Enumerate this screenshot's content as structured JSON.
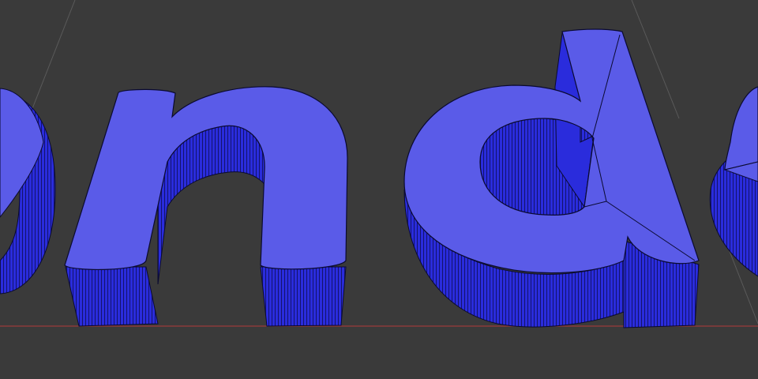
{
  "viewport": {
    "background_color": "#3a3a3a",
    "grid_line_color": "#5a5a5a",
    "x_axis_color": "#9a3a3a"
  },
  "text_object": {
    "visible_glyphs": [
      "o",
      "n",
      "d",
      "e"
    ],
    "top_face_color": "#5a5be8",
    "side_face_color": "#2a2cdc",
    "side_hatch_color": "#101060",
    "edge_color": "#0a0a30"
  }
}
